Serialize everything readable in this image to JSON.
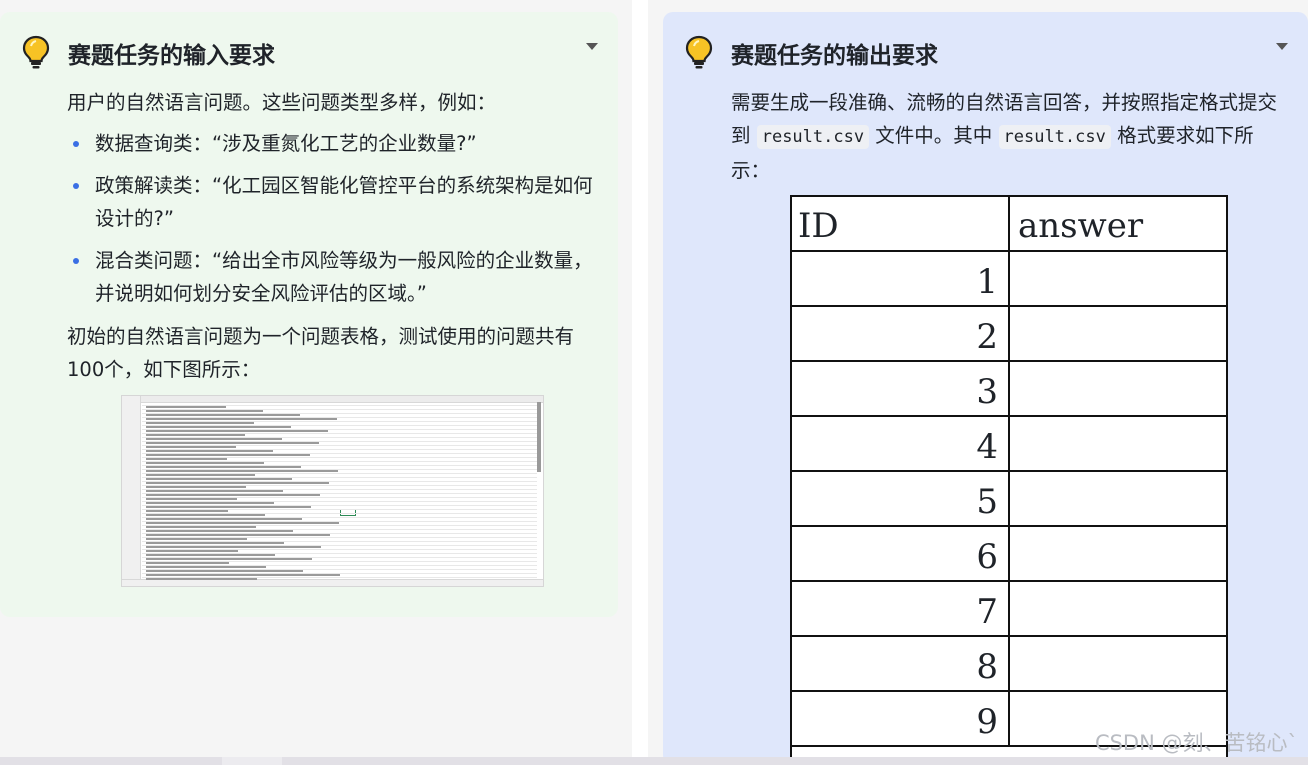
{
  "left_card": {
    "title": "赛题任务的输入要求",
    "icon": "lightbulb-icon",
    "intro": "用户的自然语言问题。这些问题类型多样，例如：",
    "bullets": [
      "数据查询类：“涉及重氮化工艺的企业数量?”",
      "政策解读类：“化工园区智能化管控平台的系统架构是如何设计的?”",
      "混合类问题：“给出全市风险等级为一般风险的企业数量，并说明如何划分安全风险评估的区域。”"
    ],
    "outro": "初始的自然语言问题为一个问题表格，测试使用的问题共有100个，如下图所示："
  },
  "right_card": {
    "title": "赛题任务的输出要求",
    "icon": "lightbulb-icon",
    "text_part1": "需要生成一段准确、流畅的自然语言回答，并按照指定格式提交到",
    "code1": "result.csv",
    "text_part2": "文件中。其中",
    "code2": "result.csv",
    "text_part3": "格式要求如下所示："
  },
  "csv_table": {
    "headers": [
      "ID",
      "answer"
    ],
    "rows": [
      "1",
      "2",
      "3",
      "4",
      "5",
      "6",
      "7",
      "8",
      "9"
    ]
  },
  "watermark": "CSDN @刻、苦铭心`",
  "colors": {
    "left_bg": "#eef8ee",
    "right_bg": "#dfe7fb",
    "bullet": "#3a6fe4",
    "bulb": "#f5b400"
  }
}
